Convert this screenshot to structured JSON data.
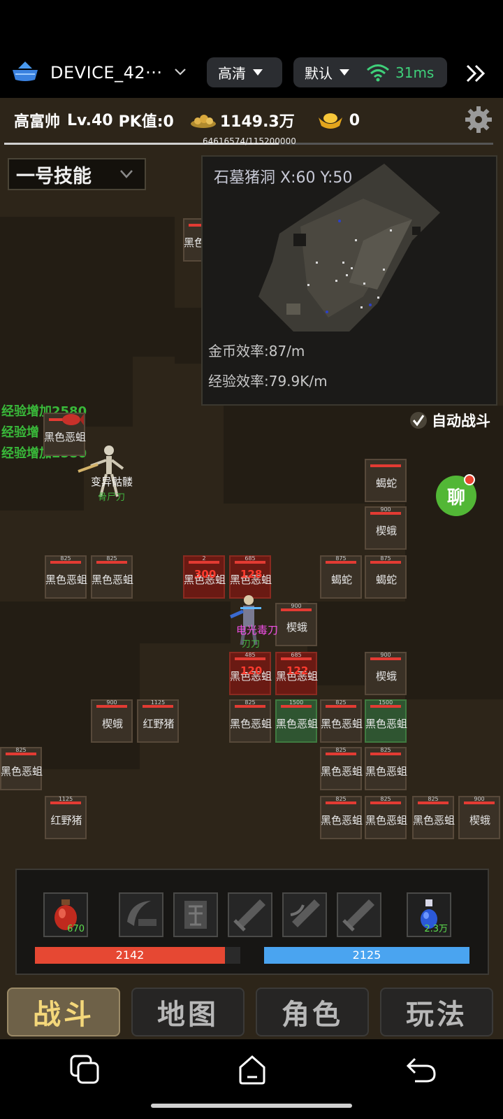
{
  "device": {
    "name": "DEVICE_42···",
    "quality": "高清",
    "mode": "默认",
    "latency": "31ms"
  },
  "hud": {
    "player_name": "高富帅",
    "level": "Lv.40",
    "pk_value": "PK值:0",
    "gold": "1149.3万",
    "ingots": "0",
    "exp_text": "64616574/115200000",
    "exp_fraction": 0.561
  },
  "skill_selector": {
    "value": "一号技能"
  },
  "minimap": {
    "title": "石墓猪洞 X:60 Y:50",
    "gold_rate": "金币效率:87/m",
    "exp_rate": "经验效率:79.9K/m"
  },
  "auto_battle": {
    "label": "自动战斗",
    "checked": true
  },
  "floating_texts": [
    "经验增加2580",
    "经验增加2580"
  ],
  "sprites": {
    "skeleton_name": "变异骷髅",
    "skeleton_sub": "骨尸刀",
    "player_pink": "电光毒刀",
    "player_sub": "刃刀"
  },
  "monsters": [
    {
      "name": "黑色恶蛆",
      "num": "",
      "state": "normal"
    },
    {
      "name": "黑色恶蛆",
      "num": "",
      "state": "normal"
    },
    {
      "name": "蝎蛇",
      "num": "",
      "state": "normal"
    },
    {
      "name": "楔蛾",
      "num": "900",
      "state": "normal"
    },
    {
      "name": "黑色恶蛆",
      "num": "825",
      "state": "normal"
    },
    {
      "name": "黑色恶蛆",
      "num": "825",
      "state": "normal"
    },
    {
      "name": "黑色恶蛆",
      "num": "2",
      "state": "hit"
    },
    {
      "name": "黑色恶蛆",
      "num": "685",
      "state": "hit"
    },
    {
      "name": "蝎蛇",
      "num": "875",
      "state": "normal"
    },
    {
      "name": "蝎蛇",
      "num": "875",
      "state": "normal"
    },
    {
      "name": "楔蛾",
      "num": "900",
      "state": "normal"
    },
    {
      "name": "黑色恶蛆",
      "num": "485",
      "state": "hit"
    },
    {
      "name": "黑色恶蛆",
      "num": "685",
      "state": "hit"
    },
    {
      "name": "楔蛾",
      "num": "900",
      "state": "normal"
    },
    {
      "name": "楔蛾",
      "num": "900",
      "state": "normal"
    },
    {
      "name": "红野猪",
      "num": "1125",
      "state": "normal"
    },
    {
      "name": "黑色恶蛆",
      "num": "825",
      "state": "normal"
    },
    {
      "name": "黑色恶蛆",
      "num": "1500",
      "state": "elite"
    },
    {
      "name": "黑色恶蛆",
      "num": "825",
      "state": "normal"
    },
    {
      "name": "黑色恶蛆",
      "num": "1500",
      "state": "elite"
    },
    {
      "name": "黑色恶蛆",
      "num": "825",
      "state": "normal"
    },
    {
      "name": "黑色恶蛆",
      "num": "825",
      "state": "normal"
    },
    {
      "name": "黑色恶蛆",
      "num": "825",
      "state": "normal"
    },
    {
      "name": "红野猪",
      "num": "1125",
      "state": "normal"
    },
    {
      "name": "黑色恶蛆",
      "num": "825",
      "state": "normal"
    },
    {
      "name": "黑色恶蛆",
      "num": "825",
      "state": "normal"
    },
    {
      "name": "黑色恶蛆",
      "num": "825",
      "state": "normal"
    },
    {
      "name": "楔蛾",
      "num": "900",
      "state": "normal"
    }
  ],
  "damage_numbers": [
    "300",
    "128",
    "120",
    "122"
  ],
  "chat": {
    "label": "聊"
  },
  "action_bar": {
    "hp_potion_count": "670",
    "mp_potion_count": "2.3万",
    "hp_value": "2142",
    "hp_fraction": 0.92,
    "mp_value": "2125",
    "mp_fraction": 1.0,
    "skills": [
      "crescent-slash-icon",
      "demon-rune-icon",
      "sword-icon",
      "winged-sword-icon",
      "sword-icon"
    ]
  },
  "tabs": [
    {
      "label": "战斗",
      "active": true
    },
    {
      "label": "地图",
      "active": false
    },
    {
      "label": "角色",
      "active": false
    },
    {
      "label": "玩法",
      "active": false
    }
  ],
  "colors": {
    "hp": "#e64833",
    "mp": "#4aa4f0",
    "exp_text_green": "#39b93a",
    "active_tab": "#f4d77a"
  }
}
